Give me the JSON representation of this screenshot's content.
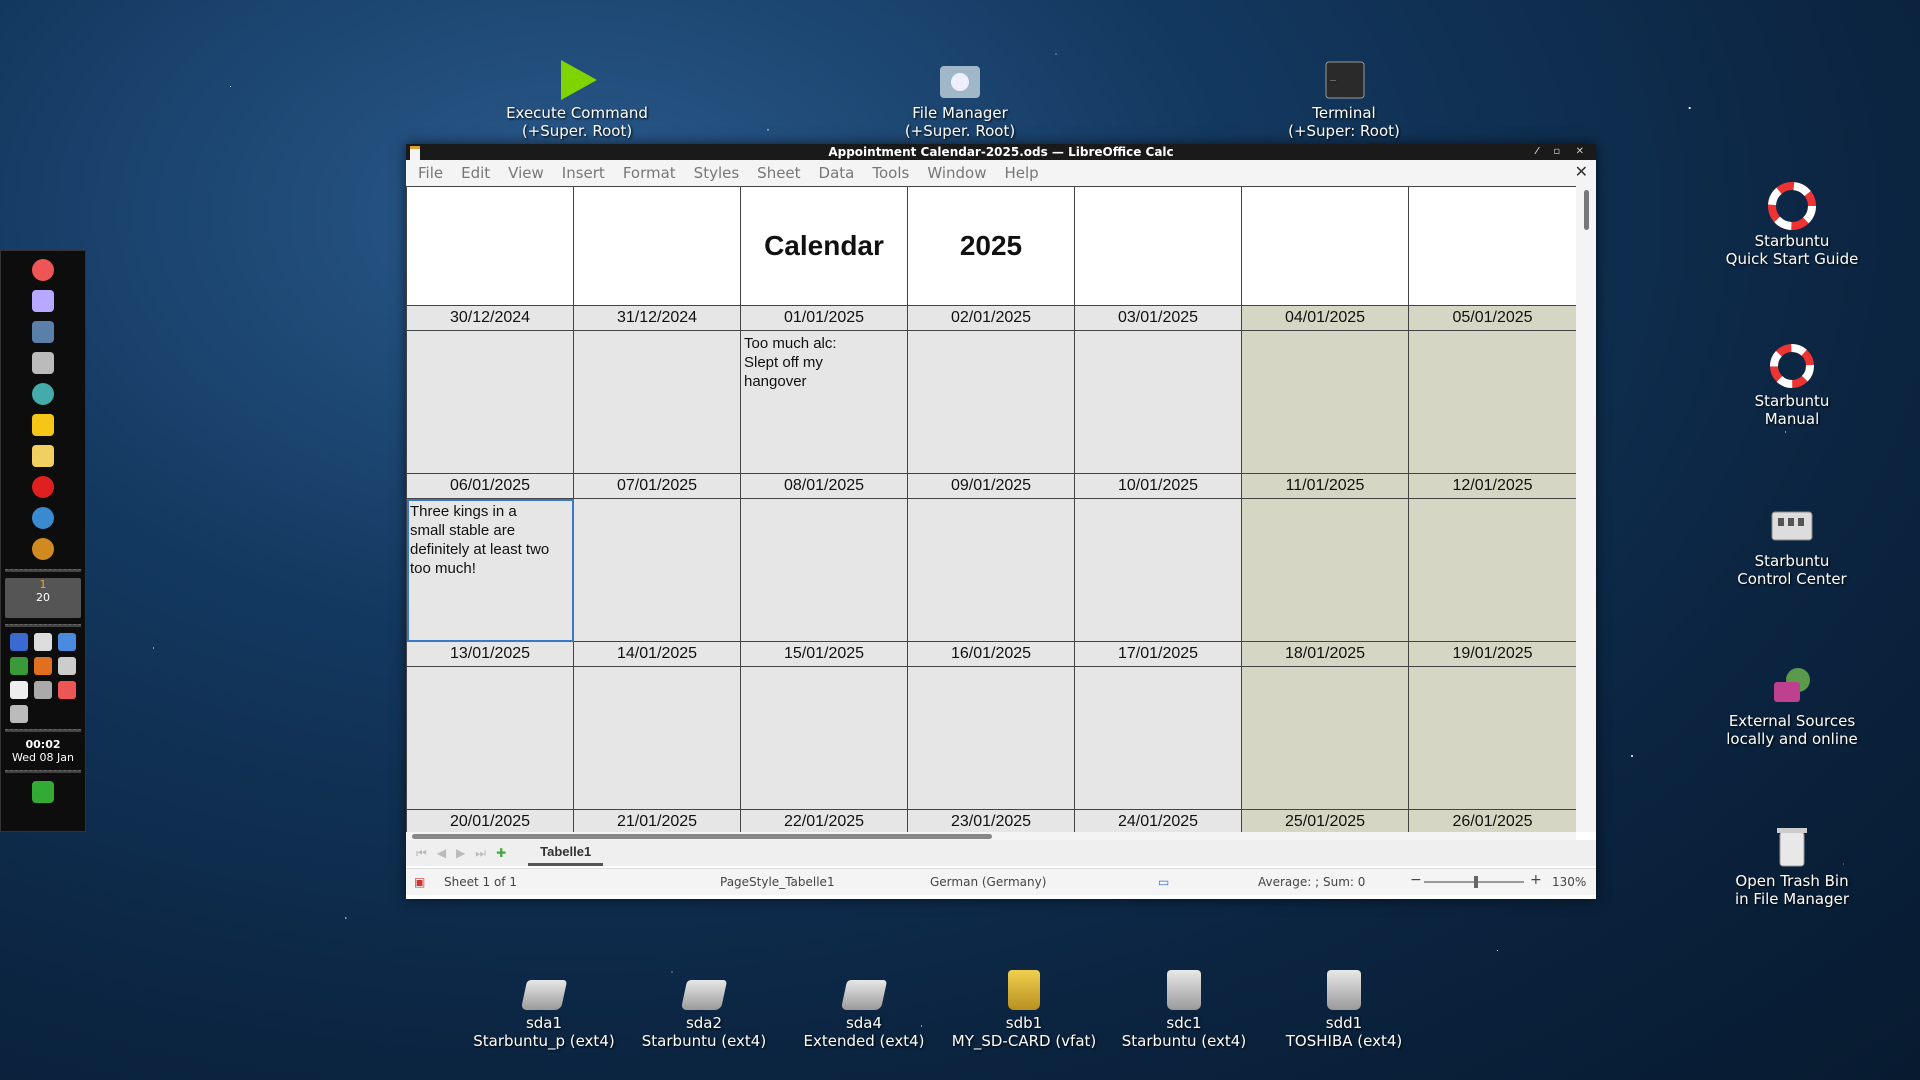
{
  "desktop": {
    "top_icons": [
      {
        "label1": "Execute Command",
        "label2": "(+Super. Root)",
        "icon": "play-icon"
      },
      {
        "label1": "File Manager",
        "label2": "(+Super. Root)",
        "icon": "folder-icon"
      },
      {
        "label1": "Terminal",
        "label2": "(+Super: Root)",
        "icon": "terminal-icon"
      }
    ],
    "right_icons": [
      {
        "label1": "Starbuntu",
        "label2": "Quick Start Guide",
        "icon": "rocket-lifebuoy-icon"
      },
      {
        "label1": "Starbuntu",
        "label2": "Manual",
        "icon": "lifebuoy-icon"
      },
      {
        "label1": "Starbuntu",
        "label2": "Control Center",
        "icon": "control-center-icon"
      },
      {
        "label1": "External Sources",
        "label2": "locally and online",
        "icon": "external-sources-icon"
      },
      {
        "label1": "Open Trash Bin",
        "label2": "in File Manager",
        "icon": "trash-icon"
      }
    ],
    "drives": [
      {
        "label1": "sda1",
        "label2": "Starbuntu_p (ext4)"
      },
      {
        "label1": "sda2",
        "label2": "Starbuntu (ext4)"
      },
      {
        "label1": "sda4",
        "label2": "Extended (ext4)"
      },
      {
        "label1": "sdb1",
        "label2": "MY_SD-CARD (vfat)"
      },
      {
        "label1": "sdc1",
        "label2": "Starbuntu (ext4)"
      },
      {
        "label1": "sdd1",
        "label2": "TOSHIBA (ext4)"
      }
    ]
  },
  "panel": {
    "calendar_top": "1",
    "calendar_bottom": "20",
    "clock_time": "00:02",
    "clock_date": "Wed 08 Jan"
  },
  "window": {
    "title": "Appointment Calendar-2025.ods — LibreOffice Calc",
    "menu": [
      "File",
      "Edit",
      "View",
      "Insert",
      "Format",
      "Styles",
      "Sheet",
      "Data",
      "Tools",
      "Window",
      "Help"
    ],
    "close_glyph": "✕"
  },
  "sheet": {
    "header_title": "Calendar",
    "header_year": "2025",
    "weeks": [
      {
        "dates": [
          "30/12/2024",
          "31/12/2024",
          "01/01/2025",
          "02/01/2025",
          "03/01/2025",
          "04/01/2025",
          "05/01/2025"
        ],
        "notes": [
          "",
          "",
          "Too much alc:\nSlept off my\nhangover",
          "",
          "",
          "",
          ""
        ]
      },
      {
        "dates": [
          "06/01/2025",
          "07/01/2025",
          "08/01/2025",
          "09/01/2025",
          "10/01/2025",
          "11/01/2025",
          "12/01/2025"
        ],
        "notes": [
          "Three kings in a\nsmall stable are\ndefinitely at least two\ntoo much!",
          "",
          "",
          "",
          "",
          "",
          ""
        ]
      },
      {
        "dates": [
          "13/01/2025",
          "14/01/2025",
          "15/01/2025",
          "16/01/2025",
          "17/01/2025",
          "18/01/2025",
          "19/01/2025"
        ],
        "notes": [
          "",
          "",
          "",
          "",
          "",
          "",
          ""
        ]
      },
      {
        "dates": [
          "20/01/2025",
          "21/01/2025",
          "22/01/2025",
          "23/01/2025",
          "24/01/2025",
          "25/01/2025",
          "26/01/2025"
        ],
        "notes": null
      }
    ],
    "tab_name": "Tabelle1"
  },
  "status": {
    "sheet_info": "Sheet 1 of 1",
    "page_style": "PageStyle_Tabelle1",
    "language": "German (Germany)",
    "sum_info": "Average: ; Sum: 0",
    "zoom_minus": "−",
    "zoom_plus": "+",
    "zoom": "130%"
  },
  "colors": {
    "weekend_cell": "#d6d6c4",
    "weekday_cell": "#e6e6e6",
    "selection": "#3a78c8"
  }
}
